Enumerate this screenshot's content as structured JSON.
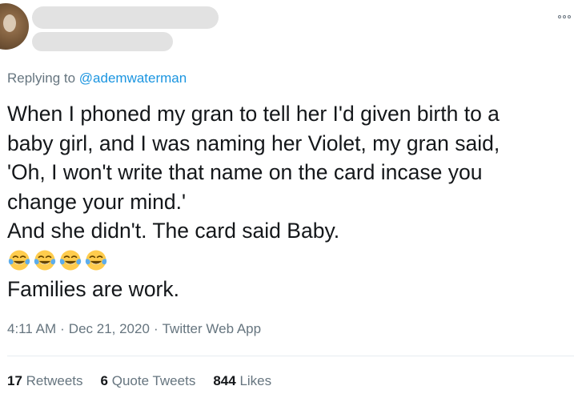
{
  "header": {
    "more_icon": "more-horizontal-icon"
  },
  "reply": {
    "prefix": "Replying to ",
    "mention": "@ademwaterman"
  },
  "tweet": {
    "lines": [
      "When I phoned my gran to tell her I'd given birth to a",
      "baby girl, and I was naming her Violet, my gran said,",
      "'Oh, I won't write that name on the card incase you",
      "change your mind.'",
      "And she didn't. The card said Baby."
    ],
    "emoji": [
      "face-with-tears-of-joy",
      "face-with-tears-of-joy",
      "face-with-tears-of-joy",
      "face-with-tears-of-joy"
    ],
    "last_line": "Families are work."
  },
  "meta": {
    "time": "4:11 AM",
    "separator": "·",
    "date": "Dec 21, 2020",
    "source": "Twitter Web App"
  },
  "stats": {
    "retweets_count": "17",
    "retweets_label": "Retweets",
    "quotes_count": "6",
    "quotes_label": "Quote Tweets",
    "likes_count": "844",
    "likes_label": "Likes"
  },
  "colors": {
    "link": "#1b95e0",
    "secondary_text": "#66757f",
    "primary_text": "#14171a",
    "redaction": "#e2e2e2"
  }
}
